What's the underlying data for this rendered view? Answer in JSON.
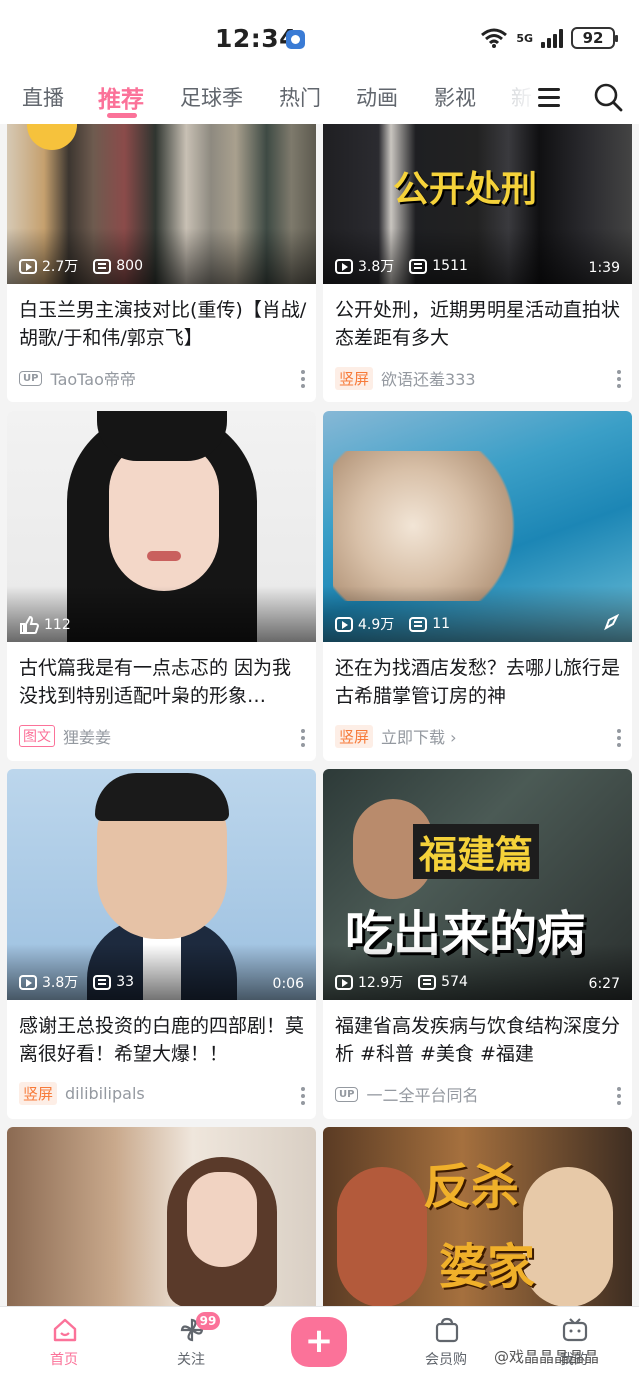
{
  "status_bar": {
    "time": "12:34",
    "network": "5G",
    "wifi_label": "6",
    "battery": "92"
  },
  "tabs": [
    "直播",
    "推荐",
    "足球季",
    "热门",
    "动画",
    "影视",
    "新"
  ],
  "active_tab": "推荐",
  "cards": [
    {
      "views": "2.7万",
      "danmaku": "800",
      "duration": "",
      "title": "白玉兰男主演技对比(重传)【肖战/胡歌/于和伟/郭京飞】",
      "badge": "UP",
      "author": "TaoTao帝帝"
    },
    {
      "views": "3.8万",
      "danmaku": "1511",
      "duration": "1:39",
      "title": "公开处刑，近期男明星活动直拍状态差距有多大",
      "badge": "竖屏",
      "author": "欲语还羞333",
      "poster_text": "公开处刑"
    },
    {
      "likes": "112",
      "title": "古代篇我是有一点忐忑的 因为我没找到特别适配叶枭的形象…",
      "badge": "图文",
      "author": "狸姜姜"
    },
    {
      "views": "4.9万",
      "danmaku": "11",
      "title": "还在为找酒店发愁？去哪儿旅行是古希腊掌管订房的神",
      "badge": "竖屏",
      "author": "立即下载 ›"
    },
    {
      "views": "3.8万",
      "danmaku": "33",
      "duration": "0:06",
      "title": "感谢王总投资的白鹿的四部剧！莫离很好看！希望大爆！！",
      "badge": "竖屏",
      "author": "dilibilipals"
    },
    {
      "views": "12.9万",
      "danmaku": "574",
      "duration": "6:27",
      "title": "福建省高发疾病与饮食结构深度分析 #科普 #美食 #福建",
      "badge": "UP",
      "author": "一二全平台同名",
      "poster_text": [
        "福建篇",
        "吃出来的病"
      ]
    },
    {
      "poster_text": ""
    },
    {
      "poster_text": [
        "反杀",
        "婆家"
      ]
    }
  ],
  "bottom_nav": {
    "home": "首页",
    "follow": "关注",
    "follow_badge": "99",
    "publish": "+",
    "vip": "会员购",
    "mine": "我的"
  },
  "watermark": "@戏晶晶晶晶晶"
}
